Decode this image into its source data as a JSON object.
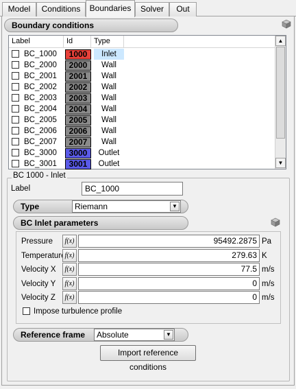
{
  "tabs": [
    {
      "label": "Model"
    },
    {
      "label": "Conditions"
    },
    {
      "label": "Boundaries"
    },
    {
      "label": "Solver"
    },
    {
      "label": "Out"
    }
  ],
  "active_tab": "Boundaries",
  "boundary_section": {
    "title": "Boundary conditions"
  },
  "list": {
    "columns": [
      "Label",
      "Id",
      "Type"
    ],
    "rows": [
      {
        "label": "BC_1000",
        "id": "1000",
        "type": "Inlet",
        "color": "#e8413a",
        "selected": true
      },
      {
        "label": "BC_2000",
        "id": "2000",
        "type": "Wall",
        "color": "#8a8a8a"
      },
      {
        "label": "BC_2001",
        "id": "2001",
        "type": "Wall",
        "color": "#8a8a8a"
      },
      {
        "label": "BC_2002",
        "id": "2002",
        "type": "Wall",
        "color": "#8a8a8a"
      },
      {
        "label": "BC_2003",
        "id": "2003",
        "type": "Wall",
        "color": "#8a8a8a"
      },
      {
        "label": "BC_2004",
        "id": "2004",
        "type": "Wall",
        "color": "#8a8a8a"
      },
      {
        "label": "BC_2005",
        "id": "2005",
        "type": "Wall",
        "color": "#8a8a8a"
      },
      {
        "label": "BC_2006",
        "id": "2006",
        "type": "Wall",
        "color": "#8a8a8a"
      },
      {
        "label": "BC_2007",
        "id": "2007",
        "type": "Wall",
        "color": "#8a8a8a"
      },
      {
        "label": "BC_3000",
        "id": "3000",
        "type": "Outlet",
        "color": "#5a5ae8"
      },
      {
        "label": "BC_3001",
        "id": "3001",
        "type": "Outlet",
        "color": "#5a5ae8"
      }
    ]
  },
  "detail": {
    "group_title": "BC 1000 -  Inlet",
    "label_caption": "Label",
    "label_value": "BC_1000",
    "type_caption": "Type",
    "type_value": "Riemann",
    "inlet_title": "BC Inlet parameters",
    "fx_label": "f(x)",
    "params": [
      {
        "name": "Pressure",
        "value": "95492.2875",
        "unit": "Pa"
      },
      {
        "name": "Temperature",
        "value": "279.63",
        "unit": "K"
      },
      {
        "name": "Velocity X",
        "value": "77.5",
        "unit": "m/s"
      },
      {
        "name": "Velocity Y",
        "value": "0",
        "unit": "m/s"
      },
      {
        "name": "Velocity Z",
        "value": "0",
        "unit": "m/s"
      }
    ],
    "turbulence_label": "Impose turbulence profile",
    "ref_frame_caption": "Reference frame",
    "ref_frame_value": "Absolute",
    "import_button": "Import reference conditions"
  }
}
